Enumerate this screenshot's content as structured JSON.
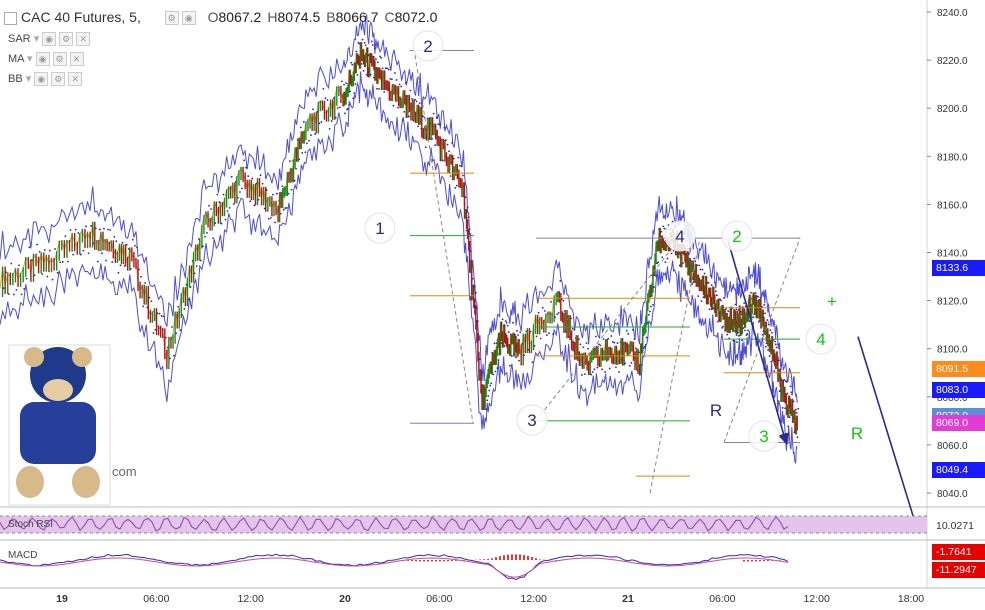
{
  "header": {
    "symbol": "CAC 40 Futures, 5,",
    "ohlc": [
      {
        "k": "O",
        "v": "8067.2"
      },
      {
        "k": "H",
        "v": "8074.5"
      },
      {
        "k": "B",
        "v": "8066.7"
      },
      {
        "k": "C",
        "v": "8072.0"
      }
    ]
  },
  "indicators": [
    "SAR",
    "MA",
    "BB"
  ],
  "panes": {
    "stoch_label": "Stoch RSI",
    "macd_label": "MACD"
  },
  "price_labels": [
    {
      "v": "8133.6",
      "color": "#1a1aff"
    },
    {
      "v": "8091.5",
      "color": "#ff8c1a"
    },
    {
      "v": "8083.0",
      "color": "#1a1aff"
    },
    {
      "v": "8072.0",
      "color": "#5b8fd9"
    },
    {
      "v": "8069.0",
      "color": "#e23bd6"
    },
    {
      "v": "8049.4",
      "color": "#1a1aff"
    }
  ],
  "pane_labels": [
    {
      "v": "10.0271",
      "color": "#ffffff",
      "fg": "#333"
    },
    {
      "v": "-1.7641",
      "color": "#e60000",
      "fg": "#fff"
    },
    {
      "v": "-11.2947",
      "color": "#e60000",
      "fg": "#fff"
    }
  ],
  "watermark_text": "com",
  "waves": [
    {
      "label": "1",
      "color": "#2b2b7f"
    },
    {
      "label": "2",
      "color": "#2b2b7f"
    },
    {
      "label": "3",
      "color": "#2b2b7f"
    },
    {
      "label": "4",
      "color": "#2b2b7f"
    },
    {
      "label": "R",
      "color": "#2b2b7f"
    },
    {
      "label": "2",
      "color": "#11c611"
    },
    {
      "label": "3",
      "color": "#11c611"
    },
    {
      "label": "4",
      "color": "#11c611"
    },
    {
      "label": "R",
      "color": "#11c611"
    },
    {
      "label": "+",
      "color": "#11c611"
    }
  ],
  "chart_data": {
    "type": "line",
    "title": "CAC 40 Futures, 5",
    "y_axis": {
      "ticks": [
        8040.0,
        8060.0,
        8080.0,
        8100.0,
        8120.0,
        8140.0,
        8160.0,
        8180.0,
        8200.0,
        8220.0,
        8240.0
      ],
      "ylim": [
        8035,
        8245
      ]
    },
    "x_axis": {
      "tick_labels": [
        "19",
        "06:00",
        "12:00",
        "20",
        "06:00",
        "12:00",
        "21",
        "06:00",
        "12:00",
        "18:00"
      ]
    },
    "series": [
      {
        "x": [
          0,
          0.05,
          0.1,
          0.14,
          0.18,
          0.22,
          0.26,
          0.3,
          0.33,
          0.37,
          0.39,
          0.41,
          0.44,
          0.47,
          0.5,
          0.52,
          0.54,
          0.56,
          0.6,
          0.63,
          0.66,
          0.69,
          0.71,
          0.73,
          0.75,
          0.77,
          0.79,
          0.8,
          0.815,
          0.83,
          0.845,
          0.86
        ],
        "values": [
          8128,
          8135,
          8148,
          8138,
          8098,
          8150,
          8170,
          8158,
          8192,
          8205,
          8222,
          8212,
          8200,
          8188,
          8165,
          8078,
          8105,
          8098,
          8120,
          8092,
          8100,
          8095,
          8145,
          8143,
          8130,
          8120,
          8110,
          8112,
          8120,
          8105,
          8080,
          8068
        ]
      }
    ],
    "fib_levels": [
      8173,
      8147,
      8122,
      8121,
      8110,
      8097,
      8088,
      8082,
      8069,
      8047
    ],
    "oscillators": {
      "stoch_rsi_last": 10.0271,
      "macd": -1.7641,
      "signal": -11.2947
    }
  }
}
